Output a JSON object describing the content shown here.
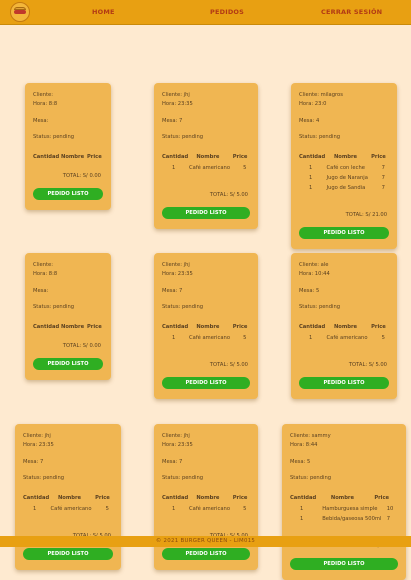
{
  "nav": {
    "home": "HOME",
    "pedidos": "PEDIDOS",
    "logout": "CERRAR SESIÓN"
  },
  "labels": {
    "cliente": "Cliente:",
    "hora": "Hora:",
    "mesa": "Mesa:",
    "status": "Status:",
    "cantidad": "Cantidad",
    "nombre": "Nombre",
    "precio": "Price",
    "total": "TOTAL: S/",
    "button": "PEDIDO LISTO"
  },
  "orders": [
    {
      "cliente": "",
      "hora": "8:8",
      "mesa": "",
      "status": "pending",
      "items": [],
      "total": "0.00"
    },
    {
      "cliente": "jhj",
      "hora": "23:35",
      "mesa": "7",
      "status": "pending",
      "items": [
        {
          "cantidad": "1",
          "nombre": "Café americano",
          "precio": "5"
        }
      ],
      "total": "5.00"
    },
    {
      "cliente": "milagros",
      "hora": "23:0",
      "mesa": "4",
      "status": "pending",
      "items": [
        {
          "cantidad": "1",
          "nombre": "Café con leche",
          "precio": "7"
        },
        {
          "cantidad": "1",
          "nombre": "Jugo de Naranja",
          "precio": "7"
        },
        {
          "cantidad": "1",
          "nombre": "Jugo de Sandia",
          "precio": "7"
        }
      ],
      "total": "21.00"
    },
    {
      "cliente": "",
      "hora": "8:8",
      "mesa": "",
      "status": "pending",
      "items": [],
      "total": "0.00"
    },
    {
      "cliente": "jhj",
      "hora": "23:35",
      "mesa": "7",
      "status": "pending",
      "items": [
        {
          "cantidad": "1",
          "nombre": "Café americano",
          "precio": "5"
        }
      ],
      "total": "5.00"
    },
    {
      "cliente": "ale",
      "hora": "10:44",
      "mesa": "5",
      "status": "pending",
      "items": [
        {
          "cantidad": "1",
          "nombre": "Café americano",
          "precio": "5"
        }
      ],
      "total": "5.00"
    },
    {
      "cliente": "jhj",
      "hora": "23:35",
      "mesa": "7",
      "status": "pending",
      "items": [
        {
          "cantidad": "1",
          "nombre": "Café americano",
          "precio": "5"
        }
      ],
      "total": "5.00"
    },
    {
      "cliente": "jhj",
      "hora": "23:35",
      "mesa": "7",
      "status": "pending",
      "items": [
        {
          "cantidad": "1",
          "nombre": "Café americano",
          "precio": "5"
        }
      ],
      "total": "5.00"
    },
    {
      "cliente": "sammy",
      "hora": "8:44",
      "mesa": "5",
      "status": "pending",
      "items": [
        {
          "cantidad": "1",
          "nombre": "Hamburguesa simple",
          "precio": "10"
        },
        {
          "cantidad": "1",
          "nombre": "Bebida/gaseosa 500ml",
          "precio": "7"
        }
      ],
      "total": "17.00"
    }
  ],
  "footer": {
    "text": "© 2021 BURGER QUEEN - LIM015"
  }
}
